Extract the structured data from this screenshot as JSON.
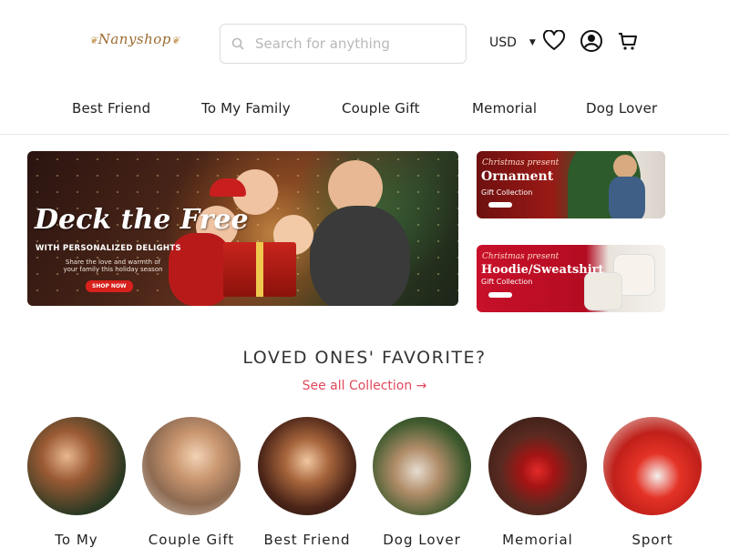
{
  "header": {
    "logo_text": "Nanyshop",
    "search_placeholder": "Search for anything",
    "currency": "USD",
    "icons": [
      "search-icon",
      "heart-icon",
      "user-icon",
      "cart-icon"
    ]
  },
  "nav": {
    "items": [
      {
        "label": "Best Friend"
      },
      {
        "label": "To My Family"
      },
      {
        "label": "Couple Gift"
      },
      {
        "label": "Memorial"
      },
      {
        "label": "Dog Lover"
      }
    ]
  },
  "hero": {
    "headline": "Deck the Free",
    "subheadline": "WITH PERSONALIZED DELIGHTS",
    "description": "Share the love and warmth of your family this holiday season",
    "cta": "SHOP NOW"
  },
  "side_banners": [
    {
      "kicker": "Christmas present",
      "title": "Ornament",
      "subtitle": "Gift Collection"
    },
    {
      "kicker": "Christmas present",
      "title": "Hoodie/Sweatshirt",
      "subtitle": "Gift Collection"
    }
  ],
  "section": {
    "title": "LOVED ONES' FAVORITE?",
    "see_all": "See all Collection →"
  },
  "categories": [
    {
      "label": "To My"
    },
    {
      "label": "Couple Gift"
    },
    {
      "label": "Best Friend"
    },
    {
      "label": "Dog Lover"
    },
    {
      "label": "Memorial"
    },
    {
      "label": "Sport"
    }
  ],
  "colors": {
    "accent": "#e0495c",
    "logo": "#9b6a2f",
    "cta": "#d8201c"
  }
}
